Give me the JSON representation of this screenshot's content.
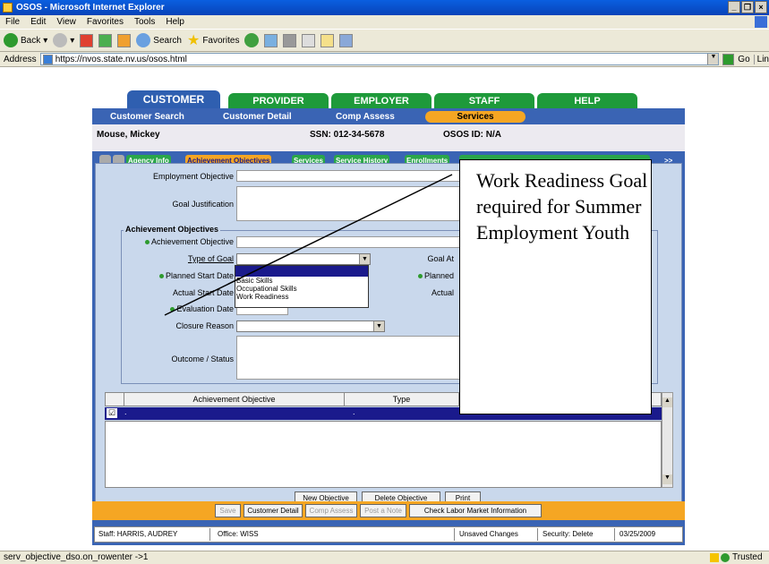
{
  "window": {
    "title": "OSOS - Microsoft Internet Explorer"
  },
  "menu": [
    "File",
    "Edit",
    "View",
    "Favorites",
    "Tools",
    "Help"
  ],
  "toolbar": {
    "back": "Back",
    "search": "Search",
    "favorites": "Favorites"
  },
  "address": {
    "label": "Address",
    "url": "https://nvos.state.nv.us/osos.html",
    "go": "Go",
    "links": "Lin"
  },
  "nav_tabs": [
    "CUSTOMER",
    "PROVIDER",
    "EMPLOYER",
    "STAFF",
    "HELP"
  ],
  "sub_nav": [
    "Customer Search",
    "Customer Detail",
    "Comp Assess",
    "Services"
  ],
  "customer": {
    "name": "Mouse, Mickey",
    "ssn": "SSN: 012-34-5678",
    "osos_id": "OSOS ID: N/A"
  },
  "page_tabs": [
    "Agency Info",
    "Achievement Objectives",
    "Services",
    "Service History",
    "Enrollments"
  ],
  "more_tab": ">>",
  "form": {
    "employment_objective": "Employment Objective",
    "goal_justification": "Goal Justification",
    "section_title": "Achievement Objectives",
    "achievement_objective": "Achievement Objective",
    "type_of_goal": "Type of Goal",
    "goal_attained": "Goal At",
    "planned_start_date": "Planned Start Date",
    "planned_end": "Planned",
    "actual_start_date": "Actual Start Date",
    "actual_end": "Actual",
    "evaluation_date": "Evaluation Date",
    "closure_reason": "Closure Reason",
    "outcome_status": "Outcome / Status"
  },
  "goal_dropdown_options": [
    "",
    "Basic Skills",
    "Occupational Skills",
    "Work Readiness"
  ],
  "grid": {
    "columns": [
      "Achievement Objective",
      "Type"
    ],
    "row_marker": "."
  },
  "buttons": {
    "new_objective": "New Objective",
    "delete_objective": "Delete Objective",
    "print": "Print"
  },
  "bottom_buttons": [
    "Save",
    "Customer Detail",
    "Comp Assess",
    "Post a Note",
    "Check Labor Market Information"
  ],
  "footer": {
    "staff": "Staff: HARRIS, AUDREY",
    "office": "Office: WISS",
    "unsaved": "Unsaved Changes",
    "security": "Security: Delete",
    "date": "03/25/2009"
  },
  "callout": {
    "text": "Work Readiness Goal required for Summer Employment Youth"
  },
  "status": {
    "left": "serv_objective_dso.on_rowenter   ->1",
    "zone": "Trusted sites"
  },
  "colors": {
    "titlebar": "#0843b8",
    "nav_customer": "#2f5fb0",
    "nav_other": "#1e9a3a",
    "services_pill": "#f5a623",
    "selected_row": "#1a1a8c",
    "panel": "#c9d8ec"
  }
}
